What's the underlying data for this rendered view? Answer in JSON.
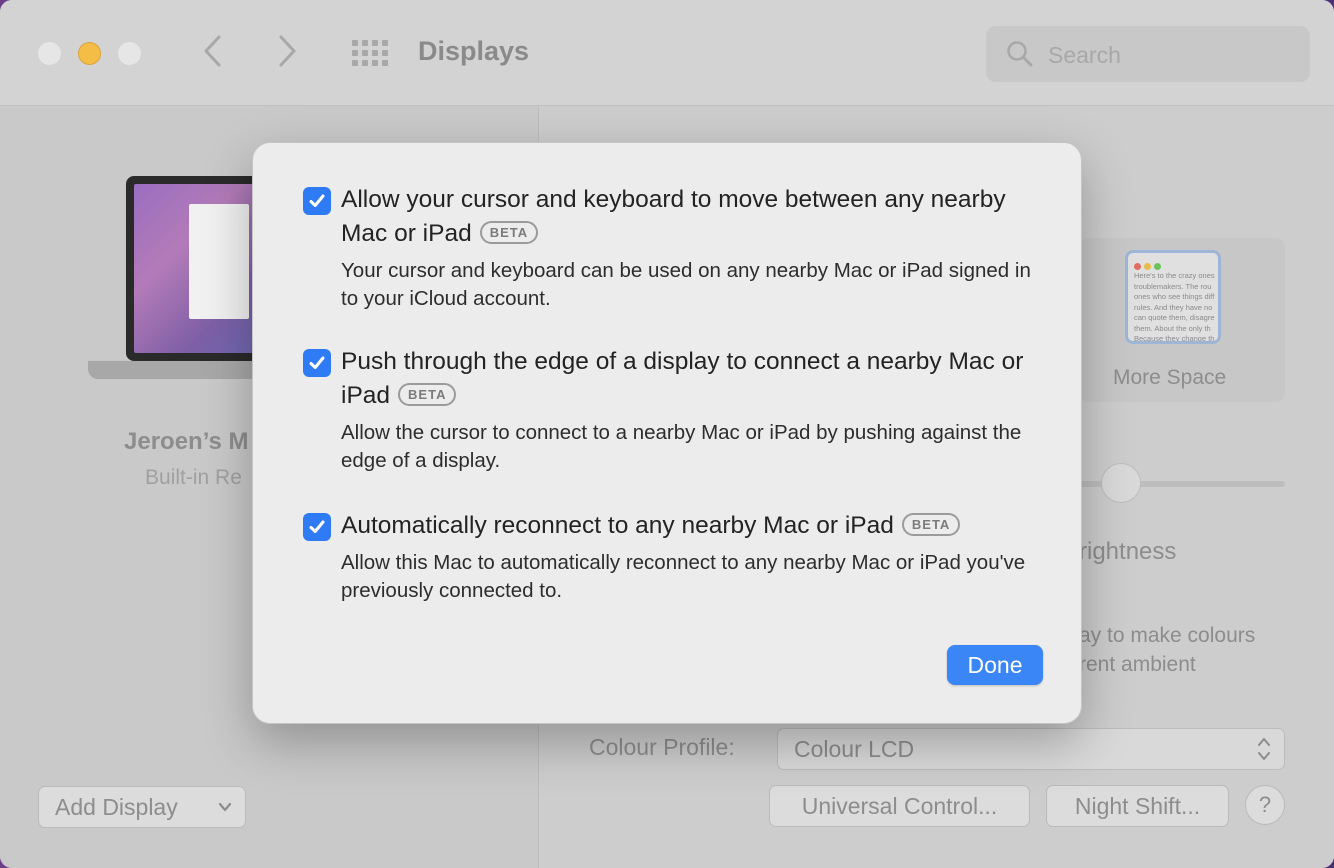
{
  "window": {
    "title": "Displays"
  },
  "search": {
    "placeholder": "Search"
  },
  "sidebar": {
    "device_name": "Jeroen’s M",
    "device_subtitle": "Built-in Re",
    "add_display_label": "Add Display"
  },
  "main": {
    "more_space_label": "More Space",
    "more_space_preview_text": "Here's to the crazy ones troublemakers. The rou ones who see things diff rules. And they have no can quote them, disagre them. About the only th Because they change th",
    "brightness_fragment": "rightness",
    "ambient_fragment_1": "ay to make colours",
    "ambient_fragment_2": "rent ambient",
    "colour_profile_label": "Colour Profile:",
    "colour_profile_value": "Colour LCD",
    "universal_control_label": "Universal Control...",
    "night_shift_label": "Night Shift...",
    "help_label": "?"
  },
  "dialog": {
    "options": [
      {
        "checked": true,
        "title": "Allow your cursor and keyboard to move between any nearby Mac or iPad",
        "badge": "BETA",
        "description": "Your cursor and keyboard can be used on any nearby Mac or iPad signed in to your iCloud account."
      },
      {
        "checked": true,
        "title": "Push through the edge of a display to connect a nearby Mac or iPad",
        "badge": "BETA",
        "description": "Allow the cursor to connect to a nearby Mac or iPad by pushing against the edge of a display."
      },
      {
        "checked": true,
        "title": "Automatically reconnect to any nearby Mac or iPad",
        "badge": "BETA",
        "description": "Allow this Mac to automatically reconnect to any nearby Mac or iPad you've previously connected to."
      }
    ],
    "done_label": "Done"
  },
  "colors": {
    "accent": "#3a86f7",
    "checkbox": "#2f7bf5",
    "minimize": "#f4bd46"
  },
  "icons": {
    "back": "chevron-left-icon",
    "forward": "chevron-right-icon",
    "show_all": "grid-icon",
    "search": "search-icon",
    "check": "checkmark-icon"
  }
}
